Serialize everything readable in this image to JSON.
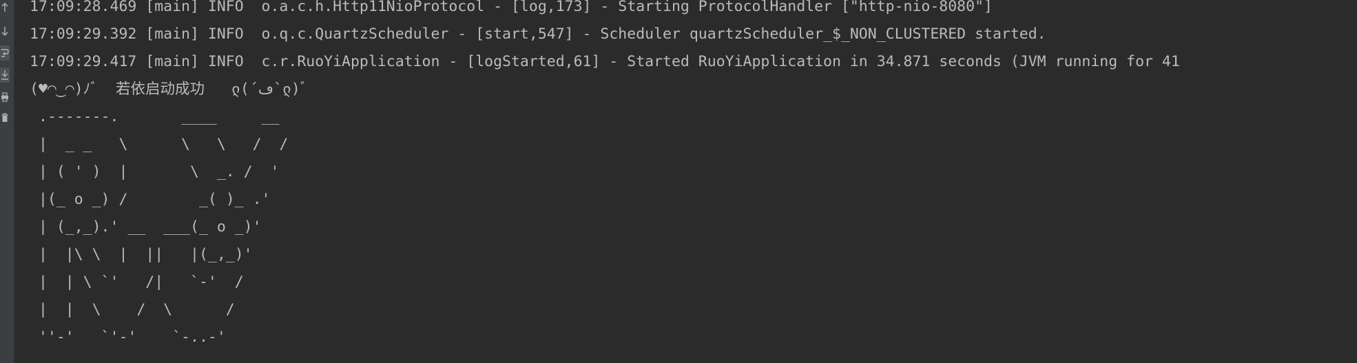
{
  "toolbar": {
    "tools": [
      {
        "name": "up-arrow-icon",
        "glyph": "↑"
      },
      {
        "name": "down-arrow-icon",
        "glyph": "↓"
      },
      {
        "name": "soft-wrap-icon",
        "glyph": "⤶"
      },
      {
        "name": "scroll-to-end-icon",
        "glyph": "⤓"
      },
      {
        "name": "print-icon",
        "glyph": "⎙"
      },
      {
        "name": "clear-trash-icon",
        "glyph": "🗑"
      }
    ]
  },
  "log": {
    "lines": [
      "17:09:28.469 [main] INFO  o.a.c.h.Http11NioProtocol - [log,173] - Starting ProtocolHandler [\"http-nio-8080\"]",
      "17:09:29.392 [main] INFO  o.q.c.QuartzScheduler - [start,547] - Scheduler quartzScheduler_$_NON_CLUSTERED started.",
      "17:09:29.417 [main] INFO  c.r.RuoYiApplication - [logStarted,61] - Started RuoYiApplication in 34.871 seconds (JVM running for 41",
      "(♥◠‿◠)ﾉﾞ  若依启动成功   ლ(´ڡ`ლ)ﾞ",
      " .-------.       ____     __",
      " |  _ _   \\      \\   \\   /  /",
      " | ( ' )  |       \\  _. /  '",
      " |(_ o _) /        _( )_ .'",
      " | (_,_).' __  ___(_ o _)'",
      " |  |\\ \\  |  ||   |(_,_)'",
      " |  | \\ `'   /|   `-'  /",
      " |  |  \\    /  \\      /",
      " ''-'   `'-'    `-..-'"
    ]
  }
}
